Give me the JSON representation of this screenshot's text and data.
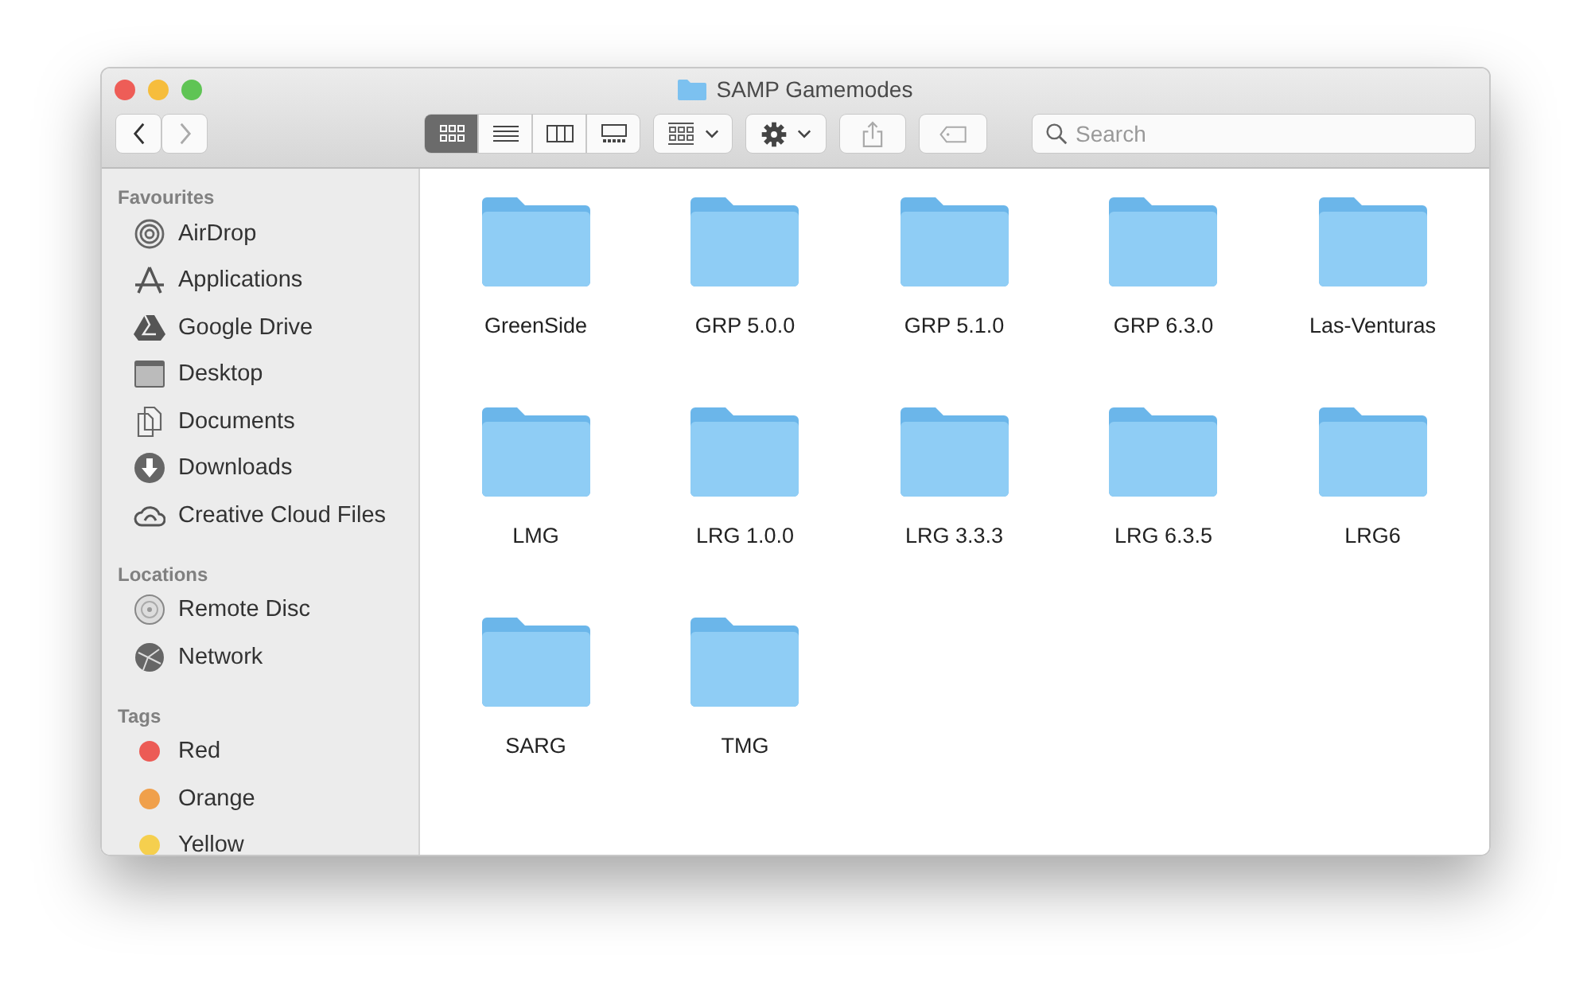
{
  "window": {
    "title": "SAMP Gamemodes"
  },
  "toolbar": {
    "view_modes": [
      {
        "selected": true
      },
      {
        "selected": false
      },
      {
        "selected": false
      },
      {
        "selected": false
      }
    ],
    "search": {
      "placeholder": "Search"
    }
  },
  "sidebar": {
    "sections": [
      {
        "title": "Favourites",
        "items": [
          {
            "label": "AirDrop"
          },
          {
            "label": "Applications"
          },
          {
            "label": "Google Drive"
          },
          {
            "label": "Desktop"
          },
          {
            "label": "Documents"
          },
          {
            "label": "Downloads"
          },
          {
            "label": "Creative Cloud Files"
          }
        ]
      },
      {
        "title": "Locations",
        "items": [
          {
            "label": "Remote Disc"
          },
          {
            "label": "Network"
          }
        ]
      },
      {
        "title": "Tags",
        "items": [
          {
            "label": "Red",
            "color": "#ec5b55"
          },
          {
            "label": "Orange",
            "color": "#f0a04b"
          },
          {
            "label": "Yellow",
            "color": "#f5cf4e"
          }
        ]
      }
    ]
  },
  "folders": [
    {
      "name": "GreenSide"
    },
    {
      "name": "GRP 5.0.0"
    },
    {
      "name": "GRP 5.1.0"
    },
    {
      "name": "GRP 6.3.0"
    },
    {
      "name": "Las-Venturas"
    },
    {
      "name": "LMG"
    },
    {
      "name": "LRG 1.0.0"
    },
    {
      "name": "LRG 3.3.3"
    },
    {
      "name": "LRG 6.3.5"
    },
    {
      "name": "LRG6"
    },
    {
      "name": "SARG"
    },
    {
      "name": "TMG"
    }
  ]
}
